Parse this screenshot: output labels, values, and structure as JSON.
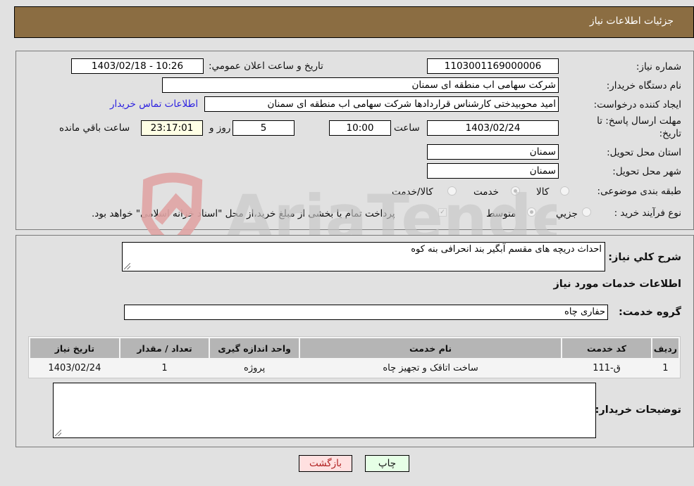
{
  "header": {
    "title": "جزئيات اطلاعات نیاز"
  },
  "form": {
    "need_number": {
      "label": "شماره نیاز:",
      "value": "1103001169000006"
    },
    "announce_datetime": {
      "label": "تاريخ و ساعت اعلان عمومي:",
      "value": "1403/02/18 - 10:26"
    },
    "buyer_org": {
      "label": "نام دستگاه خریدار:",
      "value": "شرکت سهامی اب منطقه ای سمنان"
    },
    "requester": {
      "label": "ایجاد کننده درخواست:",
      "value": "امید محوبیدختی کارشناس قراردادها شرکت سهامی اب منطقه ای سمنان",
      "contact_link": "اطلاعات تماس خریدار"
    },
    "deadline": {
      "label_line1": "مهلت ارسال پاسخ: تا",
      "label_line2": "تاریخ:",
      "date": "1403/02/24",
      "time_label": "ساعت",
      "time": "10:00",
      "days": "5",
      "days_label": "روز و",
      "remaining": "23:17:01",
      "remaining_label": "ساعت باقي مانده"
    },
    "delivery_province": {
      "label": "استان محل تحویل:",
      "value": "سمنان"
    },
    "delivery_city": {
      "label": "شهر محل تحویل:",
      "value": "سمنان"
    },
    "category": {
      "label": "طبقه بندی موضوعی:",
      "options": [
        "کالا",
        "خدمت",
        "کالا/خدمت"
      ],
      "selected": "خدمت"
    },
    "purchase_type": {
      "label": "نوع فرآیند خرید :",
      "options": [
        "جزیي",
        "متوسط"
      ],
      "selected": "متوسط",
      "treasury_note": "پرداخت تمام یا بخشی از مبلغ خرید،از محل \"اسناد خزانه اسلامی\" خواهد بود.",
      "treasury_checked": true
    }
  },
  "details": {
    "description_label": "شرح کلي نياز:",
    "description": "احداث دریچه های مقسم آبگیر بند انحرافی بنه کوه",
    "services_heading": "اطلاعات خدمات مورد نیاز",
    "service_group_label": "گروه خدمت:",
    "service_group": "حفاری چاه",
    "table": {
      "headers": [
        "ردیف",
        "کد خدمت",
        "نام خدمت",
        "واحد اندازه گیری",
        "تعداد / مقدار",
        "تاریخ نیاز"
      ],
      "rows": [
        [
          "1",
          "ق-111",
          "ساخت اتاقک و تجهیز چاه",
          "پروژه",
          "1",
          "1403/02/24"
        ]
      ]
    },
    "buyer_notes_label": "توضیحات خریدار:",
    "buyer_notes": ""
  },
  "buttons": {
    "print": "چاپ",
    "back": "بازگشت"
  },
  "watermark": {
    "text": "AriaTender.neT"
  }
}
